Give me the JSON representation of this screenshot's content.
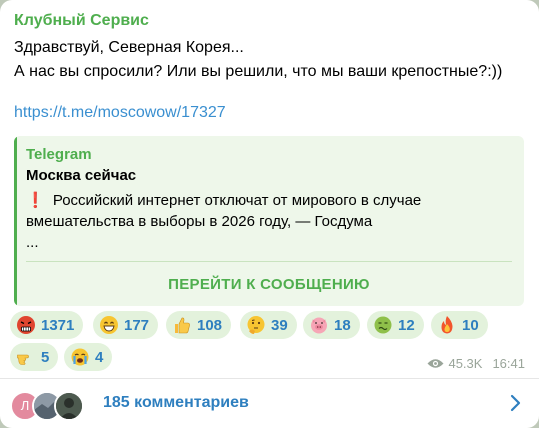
{
  "message": {
    "sender": "Клубный Сервис",
    "line1": "Здравствуй, Северная Корея...",
    "line2": "А нас вы спросили? Или вы решили, что мы ваши крепостные?:))",
    "link": "https://t.me/moscowow/17327"
  },
  "preview": {
    "site": "Telegram",
    "title": "Москва сейчас",
    "excl": "❗",
    "body": "Российский интернет отключат от мирового в случае вмешательства в выборы в 2026 году, — Госдума",
    "ellipsis": "...",
    "button": "ПЕРЕЙТИ К СООБЩЕНИЮ"
  },
  "reactions": [
    {
      "emoji": "angry-face",
      "count": "1371"
    },
    {
      "emoji": "grinning-face",
      "count": "177"
    },
    {
      "emoji": "thumbs-up",
      "count": "108"
    },
    {
      "emoji": "thinking-face",
      "count": "39"
    },
    {
      "emoji": "pig-face",
      "count": "18"
    },
    {
      "emoji": "nauseated-face",
      "count": "12"
    },
    {
      "emoji": "fire",
      "count": "10"
    },
    {
      "emoji": "pointing-hand",
      "count": "5"
    },
    {
      "emoji": "crying-face",
      "count": "4"
    }
  ],
  "meta": {
    "views": "45.3K",
    "time": "16:41"
  },
  "comments": {
    "avatar_letter": "Л",
    "label": "185 комментариев"
  },
  "colors": {
    "accent_green": "#4fae4e",
    "link_blue": "#3a8fd0",
    "reaction_bg": "#e3f2dc"
  }
}
